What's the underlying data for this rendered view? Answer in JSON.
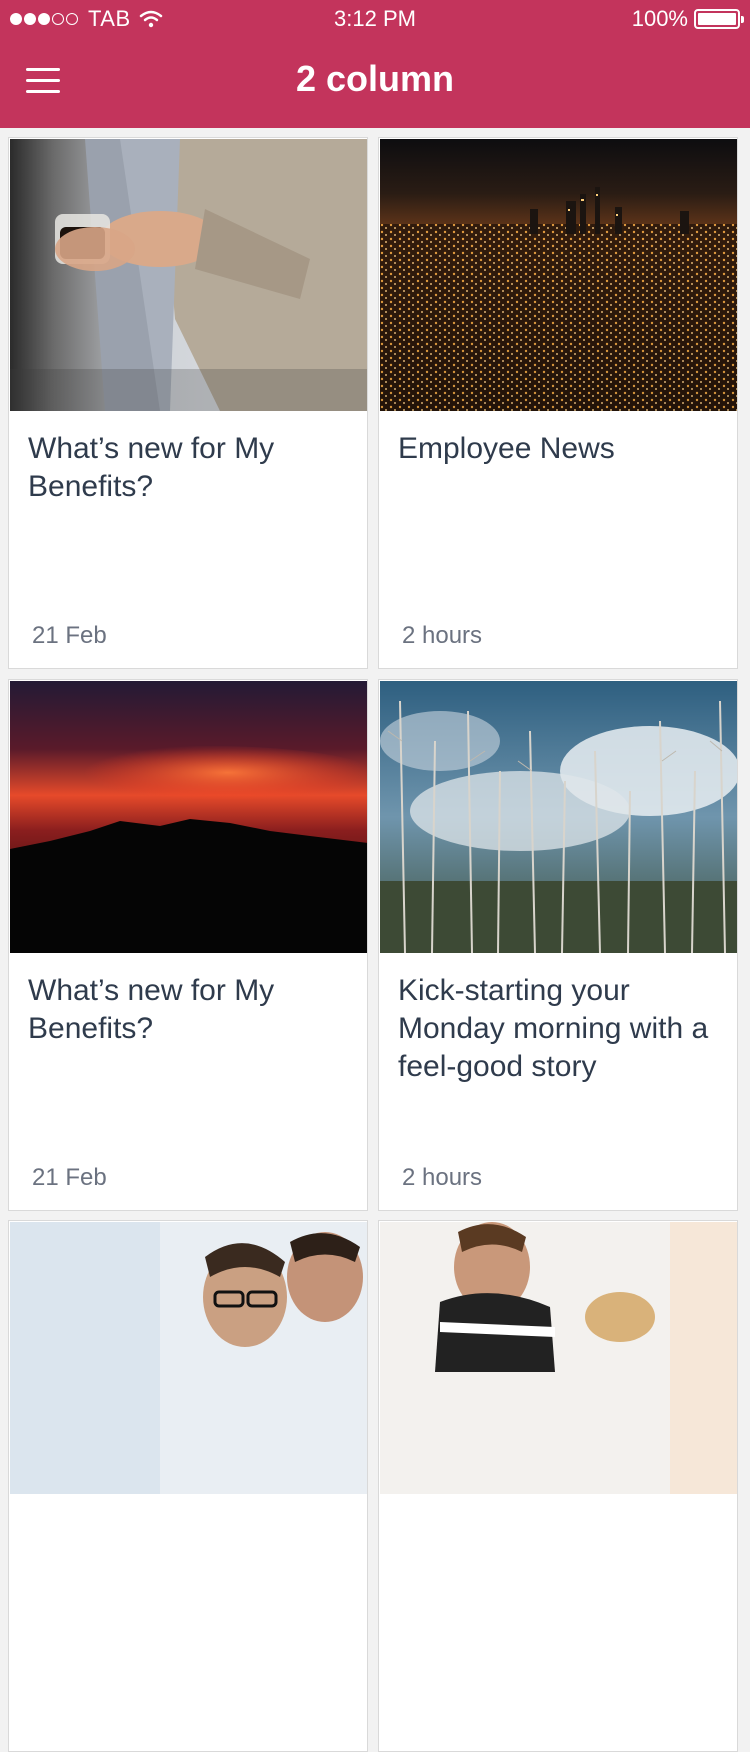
{
  "status_bar": {
    "carrier": "TAB",
    "time": "3:12 PM",
    "battery": "100%",
    "signal_bars": 3
  },
  "header": {
    "title": "2 column",
    "menu_icon": "hamburger-menu-icon"
  },
  "colors": {
    "header_bg": "#c3345c",
    "title_text": "#2f3b4c",
    "meta_text": "#6b7280"
  },
  "cards": [
    {
      "title": "What’s new for My Benefits?",
      "date": "21 Feb",
      "image": "coffee-businessman-photo"
    },
    {
      "title": "Employee News",
      "date": "2 hours",
      "image": "city-night-lights-photo"
    },
    {
      "title": "What’s new for My Benefits?",
      "date": "21 Feb",
      "image": "red-sunset-mountains-photo"
    },
    {
      "title": "Kick-starting your Monday morning with a feel-good story",
      "date": "2 hours",
      "image": "bare-trees-cloudy-sky-photo"
    },
    {
      "title": "",
      "date": "",
      "image": "office-colleagues-photo"
    },
    {
      "title": "",
      "date": "",
      "image": "smiling-man-office-photo"
    }
  ]
}
